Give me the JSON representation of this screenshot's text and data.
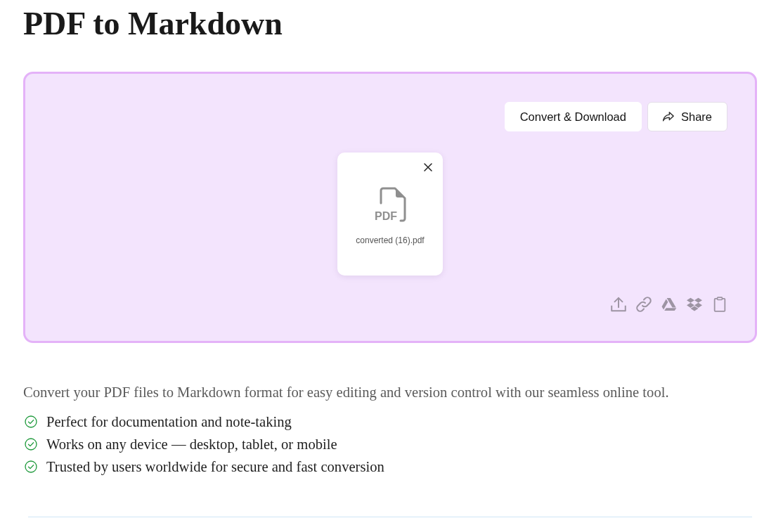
{
  "page": {
    "title": "PDF to Markdown"
  },
  "dropzone": {
    "actions": [
      {
        "label": "Convert & Download",
        "kind": "plain"
      },
      {
        "label": "Share",
        "kind": "share"
      }
    ],
    "files": [
      {
        "name": "converted (16).pdf",
        "badge": "PDF"
      }
    ]
  },
  "description": "Convert your PDF files to Markdown format for easy editing and version control with our seamless online tool.",
  "features": [
    "Perfect for documentation and note-taking",
    "Works on any device — desktop, tablet, or mobile",
    "Trusted by users worldwide for secure and fast conversion"
  ]
}
